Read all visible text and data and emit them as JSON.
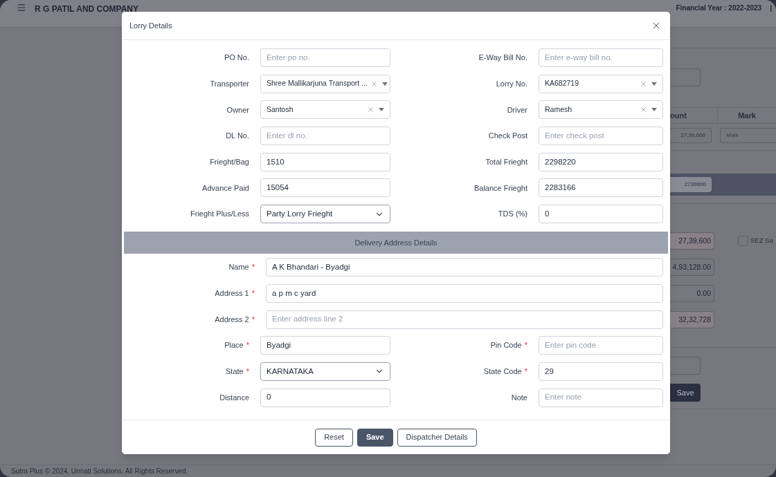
{
  "header": {
    "company": "R G PATIL AND COMPANY",
    "financial_year": "Financial Year : 2022-2023",
    "separator": "|"
  },
  "background": {
    "table_columns": [
      "ount",
      "Mark"
    ],
    "row_amount": "27,39,600",
    "mark_placeholder": "Mark",
    "bar_value": "2739600",
    "totals": [
      {
        "value": "27,39,600",
        "highlighted": true
      },
      {
        "value": "4,93,128.00",
        "highlighted": false
      },
      {
        "value": "0.00",
        "highlighted": false
      },
      {
        "value": "32,32,728",
        "highlighted": true
      }
    ],
    "sez_checkbox": {
      "label": "SEZ Sa",
      "checked": false
    },
    "save_button": "Save"
  },
  "modal": {
    "title": "Lorry Details",
    "required_mark": "*",
    "rows": [
      [
        {
          "label": "PO No.",
          "kind": "text",
          "placeholder": "Enter po no.",
          "required": false
        },
        {
          "label": "E-Way Bill No.",
          "kind": "text",
          "placeholder": "Enter e-way bill no.",
          "required": false
        }
      ],
      [
        {
          "label": "Transporter",
          "kind": "combo",
          "value": "Shree Mallikarjuna Transport ...",
          "required": false
        },
        {
          "label": "Lorry No.",
          "kind": "combo",
          "value": "KA682719",
          "required": false
        }
      ],
      [
        {
          "label": "Owner",
          "kind": "combo",
          "value": "Santosh",
          "required": false
        },
        {
          "label": "Driver",
          "kind": "combo",
          "value": "Ramesh",
          "required": false
        }
      ],
      [
        {
          "label": "DL No.",
          "kind": "text",
          "placeholder": "Enter dl no.",
          "required": false
        },
        {
          "label": "Check Post",
          "kind": "text",
          "placeholder": "Enter check post",
          "required": false
        }
      ],
      [
        {
          "label": "Frieght/Bag",
          "kind": "text",
          "value": "1510",
          "required": false
        },
        {
          "label": "Total Frieght",
          "kind": "text",
          "value": "2298220",
          "required": false
        }
      ],
      [
        {
          "label": "Advance Paid",
          "kind": "text",
          "value": "15054",
          "required": false
        },
        {
          "label": "Balance Frieght",
          "kind": "text",
          "value": "2283166",
          "required": false
        }
      ],
      [
        {
          "label": "Frieght Plus/Less",
          "kind": "select",
          "value": "Party Lorry Frieght",
          "required": false
        },
        {
          "label": "TDS (%)",
          "kind": "text",
          "value": "0",
          "required": false
        }
      ]
    ],
    "section_title": "Delivery Address Details",
    "address_rows": [
      [
        {
          "label": "Name",
          "kind": "text",
          "value": "A K Bhandari - Byadgi",
          "required": true
        }
      ],
      [
        {
          "label": "Address 1",
          "kind": "text",
          "value": "a p m c yard",
          "required": true
        }
      ],
      [
        {
          "label": "Address 2",
          "kind": "text",
          "placeholder": "Enter address line 2",
          "required": true
        }
      ],
      [
        {
          "label": "Place",
          "kind": "text",
          "value": "Byadgi",
          "required": true
        },
        {
          "label": "Pin Code",
          "kind": "text",
          "placeholder": "Enter pin code",
          "required": true
        }
      ],
      [
        {
          "label": "State",
          "kind": "select",
          "value": "KARNATAKA",
          "required": true
        },
        {
          "label": "State Code",
          "kind": "text",
          "value": "29",
          "required": true
        }
      ],
      [
        {
          "label": "Distance",
          "kind": "text",
          "value": "0",
          "required": false
        },
        {
          "label": "Note",
          "kind": "text",
          "placeholder": "Enter note",
          "required": false
        }
      ]
    ],
    "buttons": [
      {
        "label": "Reset",
        "primary": false
      },
      {
        "label": "Save",
        "primary": true
      },
      {
        "label": "Dispatcher Details",
        "primary": false
      }
    ]
  },
  "footer": "Sutra Plus © 2024, Unnati Solutions. All Rights Reserved."
}
